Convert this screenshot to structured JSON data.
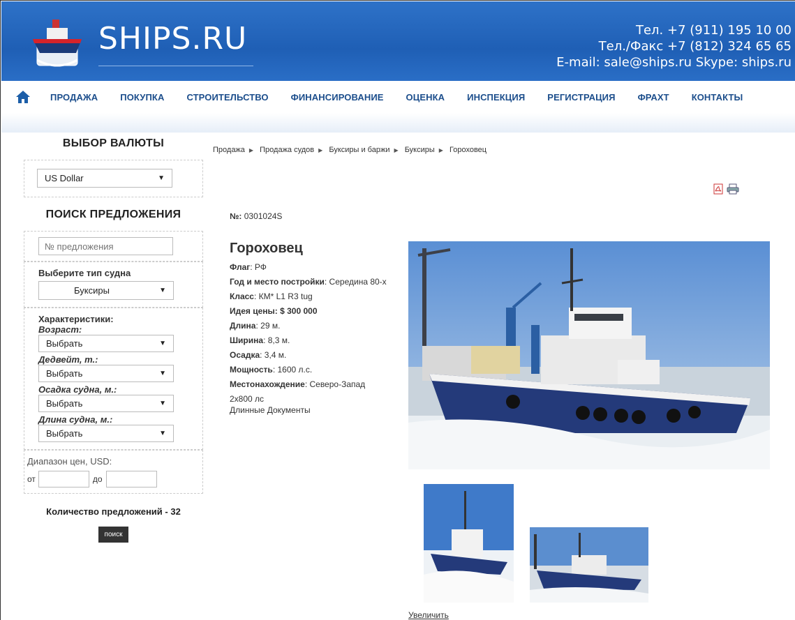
{
  "header": {
    "logo_text": "SHIPS.RU",
    "phone": "Тел. +7 (911) 195 10 00",
    "fax": "Тел./Факс +7 (812) 324 65 65",
    "email_skype": "E-mail: sale@ships.ru  Skype: ships.ru"
  },
  "nav": {
    "items": [
      "ПРОДАЖА",
      "ПОКУПКА",
      "СТРОИТЕЛЬСТВО",
      "ФИНАНСИРОВАНИЕ",
      "ОЦЕНКА",
      "ИНСПЕКЦИЯ",
      "РЕГИСТРАЦИЯ",
      "ФРАХТ",
      "КОНТАКТЫ"
    ]
  },
  "sidebar": {
    "currency_title": "ВЫБОР ВАЛЮТЫ",
    "currency_value": "US Dollar",
    "search_title": "ПОИСК ПРЕДЛОЖЕНИЯ",
    "offer_number_placeholder": "№ предложения",
    "ship_type_label": "Выберите тип судна",
    "ship_type_value": "Буксиры",
    "characteristics_label": "Характеристики:",
    "age_label": "Возраст:",
    "deadweight_label": "Дедвейт, т.:",
    "draft_label": "Осадка судна, м.:",
    "length_label": "Длина судна, м.:",
    "choose": "Выбрать",
    "price_range_label": "Диапазон цен, USD:",
    "from_label": "от",
    "to_label": "до",
    "offer_count": "Количество предложений - 32",
    "search_button": "поиск"
  },
  "breadcrumb": [
    "Продажа",
    "Продажа судов",
    "Буксиры и баржи",
    "Буксиры",
    "Гороховец"
  ],
  "listing": {
    "number_label": "№:",
    "number": "0301024S",
    "title": "Гороховец",
    "flag_label": "Флаг",
    "flag": ": РФ",
    "built_label": "Год и место постройки",
    "built": ": Середина 80-х",
    "class_label": "Класс",
    "class": ": КМ* L1 R3 tug",
    "price_label": "Идея цены: $ 300 000",
    "length_label": "Длина",
    "length": ": 29 м.",
    "width_label": "Ширина",
    "width": ": 8,3 м.",
    "draft_label": "Осадка",
    "draft": ": 3,4 м.",
    "power_label": "Мощность",
    "power": ": 1600 л.с.",
    "location_label": "Местонахождение",
    "location": ": Северо-Запад",
    "engines": "2х800 лс",
    "docs": "Длинные Документы",
    "zoom_link": "Увеличить"
  },
  "colors": {
    "header_blue": "#2569c0",
    "nav_text": "#1c4e8c"
  }
}
